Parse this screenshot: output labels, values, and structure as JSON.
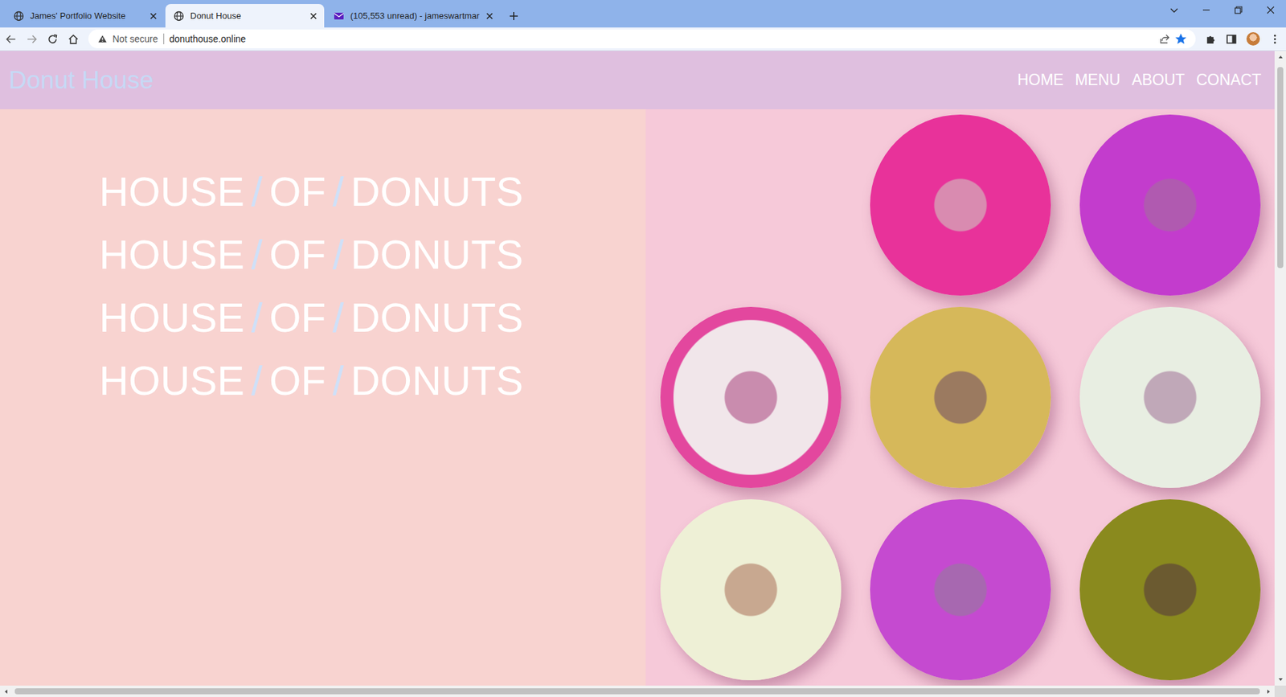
{
  "tabs": [
    {
      "label": "James' Portfolio Website",
      "selected": false,
      "kind": "globe"
    },
    {
      "label": "Donut House",
      "selected": true,
      "kind": "globe"
    },
    {
      "label": "(105,553 unread) - jameswartmar",
      "selected": false,
      "kind": "mail"
    }
  ],
  "address_bar": {
    "security": "Not secure",
    "url": "donuthouse.online",
    "bookmarked": true
  },
  "site": {
    "logo": "Donut House",
    "nav": [
      {
        "label": "HOME"
      },
      {
        "label": "MENU"
      },
      {
        "label": "ABOUT"
      },
      {
        "label": "CONACT"
      }
    ],
    "headline": [
      {
        "parts": [
          {
            "text": "HOUSE",
            "color": "#ffffff"
          },
          {
            "text": "/",
            "color": "#cfe0f8"
          },
          {
            "text": "OF",
            "color": "#ffffff"
          },
          {
            "text": "/",
            "color": "#cfe0f8"
          },
          {
            "text": "DONUTS",
            "color": "#ffffff"
          }
        ]
      },
      {
        "parts": [
          {
            "text": "HOUSE",
            "color": "#ffffff"
          },
          {
            "text": "/",
            "color": "#cfe0f8"
          },
          {
            "text": "OF",
            "color": "#ffffff"
          },
          {
            "text": "/",
            "color": "#cfe0f8"
          },
          {
            "text": "DONUTS",
            "color": "#ffffff"
          }
        ]
      },
      {
        "parts": [
          {
            "text": "HOUSE",
            "color": "#ffffff"
          },
          {
            "text": "/",
            "color": "#cfe0f8"
          },
          {
            "text": "OF",
            "color": "#ffffff"
          },
          {
            "text": "/",
            "color": "#cfe0f8"
          },
          {
            "text": "DONUTS",
            "color": "#ffffff"
          }
        ]
      },
      {
        "parts": [
          {
            "text": "HOUSE",
            "color": "#ffffff"
          },
          {
            "text": "/",
            "color": "#cfe0f8"
          },
          {
            "text": "OF",
            "color": "#ffffff"
          },
          {
            "text": "/",
            "color": "#cfe0f8"
          },
          {
            "text": "DONUTS",
            "color": "#ffffff"
          }
        ]
      }
    ]
  }
}
